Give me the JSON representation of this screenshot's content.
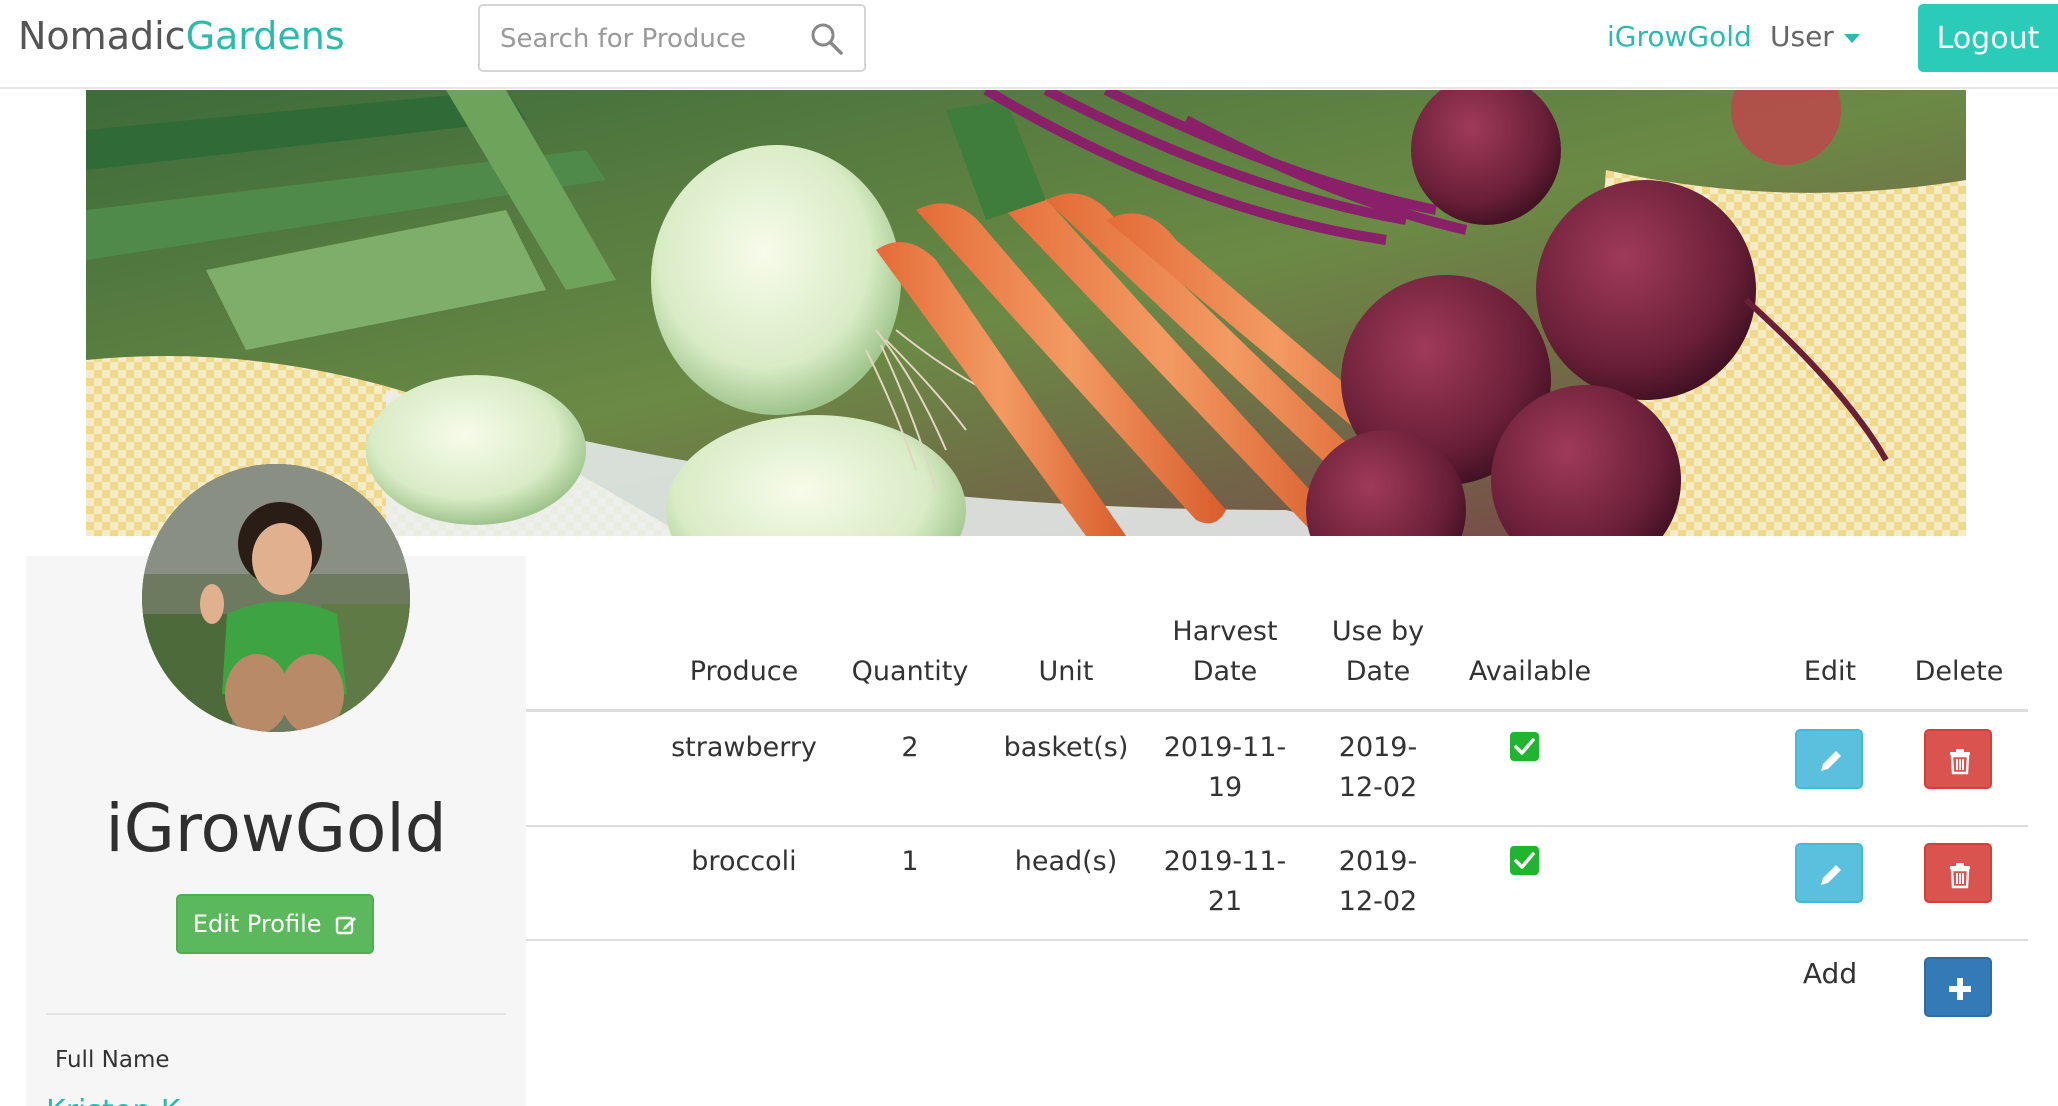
{
  "navbar": {
    "brand_part1": "Nomadic",
    "brand_part2": "Gardens",
    "search_placeholder": "Search for Produce",
    "search_icon": "search-icon",
    "username": "iGrowGold",
    "user_menu_label": "User",
    "logout_label": "Logout"
  },
  "banner": {
    "image": "vegetables-banner"
  },
  "profile": {
    "username": "iGrowGold",
    "edit_label": "Edit Profile",
    "full_name_label": "Full Name",
    "full_name_value": "Kristen K"
  },
  "table": {
    "headers": {
      "produce": "Produce",
      "quantity": "Quantity",
      "unit": "Unit",
      "harvest_line1": "Harvest",
      "harvest_line2": "Date",
      "useby_line1": "Use by",
      "useby_line2": "Date",
      "available": "Available",
      "edit": "Edit",
      "delete": "Delete"
    },
    "rows": [
      {
        "produce": "strawberry",
        "quantity": "2",
        "unit": "basket(s)",
        "harvest_line1": "2019-11-",
        "harvest_line2": "19",
        "useby_line1": "2019-",
        "useby_line2": "12-02",
        "available": true
      },
      {
        "produce": "broccoli",
        "quantity": "1",
        "unit": "head(s)",
        "harvest_line1": "2019-11-",
        "harvest_line2": "21",
        "useby_line1": "2019-",
        "useby_line2": "12-02",
        "available": true
      }
    ],
    "add_label": "Add"
  },
  "colors": {
    "accent": "#2bbbad",
    "edit_button": "#5bc0de",
    "delete_button": "#d9534f",
    "add_button": "#337ab7",
    "edit_profile_button": "#5cb85c",
    "available_check": "#20b430"
  }
}
